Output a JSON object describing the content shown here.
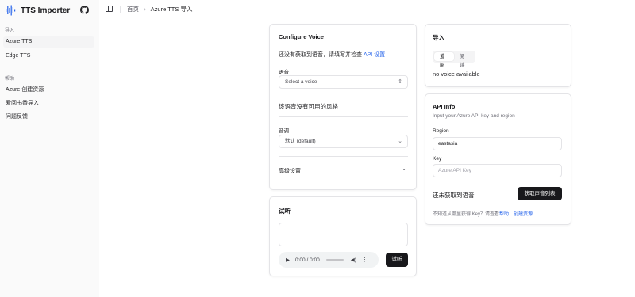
{
  "app": {
    "title": "TTS Importer"
  },
  "sidebar": {
    "groups": [
      {
        "label": "导入",
        "items": [
          "Azure TTS",
          "Edge TTS"
        ]
      },
      {
        "label": "帮助",
        "items": [
          "Azure 创建资源",
          "爱阅书香导入",
          "问题反馈"
        ]
      }
    ]
  },
  "breadcrumb": {
    "home": "首页",
    "current": "Azure TTS 导入"
  },
  "configure": {
    "title": "Configure Voice",
    "notice_text": "还没有获取到语音，请填写并检查",
    "notice_link": "API 设置",
    "voice_label": "语音",
    "voice_placeholder": "Select a voice",
    "no_style_text": "该语音没有可用的风格",
    "pitch_label": "音调",
    "pitch_value": "默认 (default)",
    "advanced_label": "高级设置"
  },
  "preview": {
    "title": "试听",
    "audio_time": "0:00 / 0:00",
    "button": "试听"
  },
  "import": {
    "title": "导入",
    "tabs": [
      "爱阅",
      "阅读"
    ],
    "no_voice": "no voice available"
  },
  "api": {
    "title": "API Info",
    "subtitle": "Input your Azure API key and region",
    "region_label": "Region",
    "region_value": "eastasia",
    "key_label": "Key",
    "key_placeholder": "Azure API Key",
    "status_text": "还未获取到语音",
    "fetch_button": "获取声音列表",
    "help_text": "不知道从哪里获得 Key？请查看",
    "help_link1": "帮助",
    "help_sep": "：",
    "help_link2": "创建资源"
  },
  "colors": {
    "accent": "#2563eb",
    "dark": "#18181b",
    "border": "#e4e4e7"
  },
  "icons": [
    "waveform-logo-icon",
    "github-icon",
    "sidebar-toggle-icon",
    "chevron-right-icon",
    "chevron-up-down-icon",
    "chevron-down-icon",
    "play-icon",
    "volume-icon",
    "more-icon"
  ]
}
